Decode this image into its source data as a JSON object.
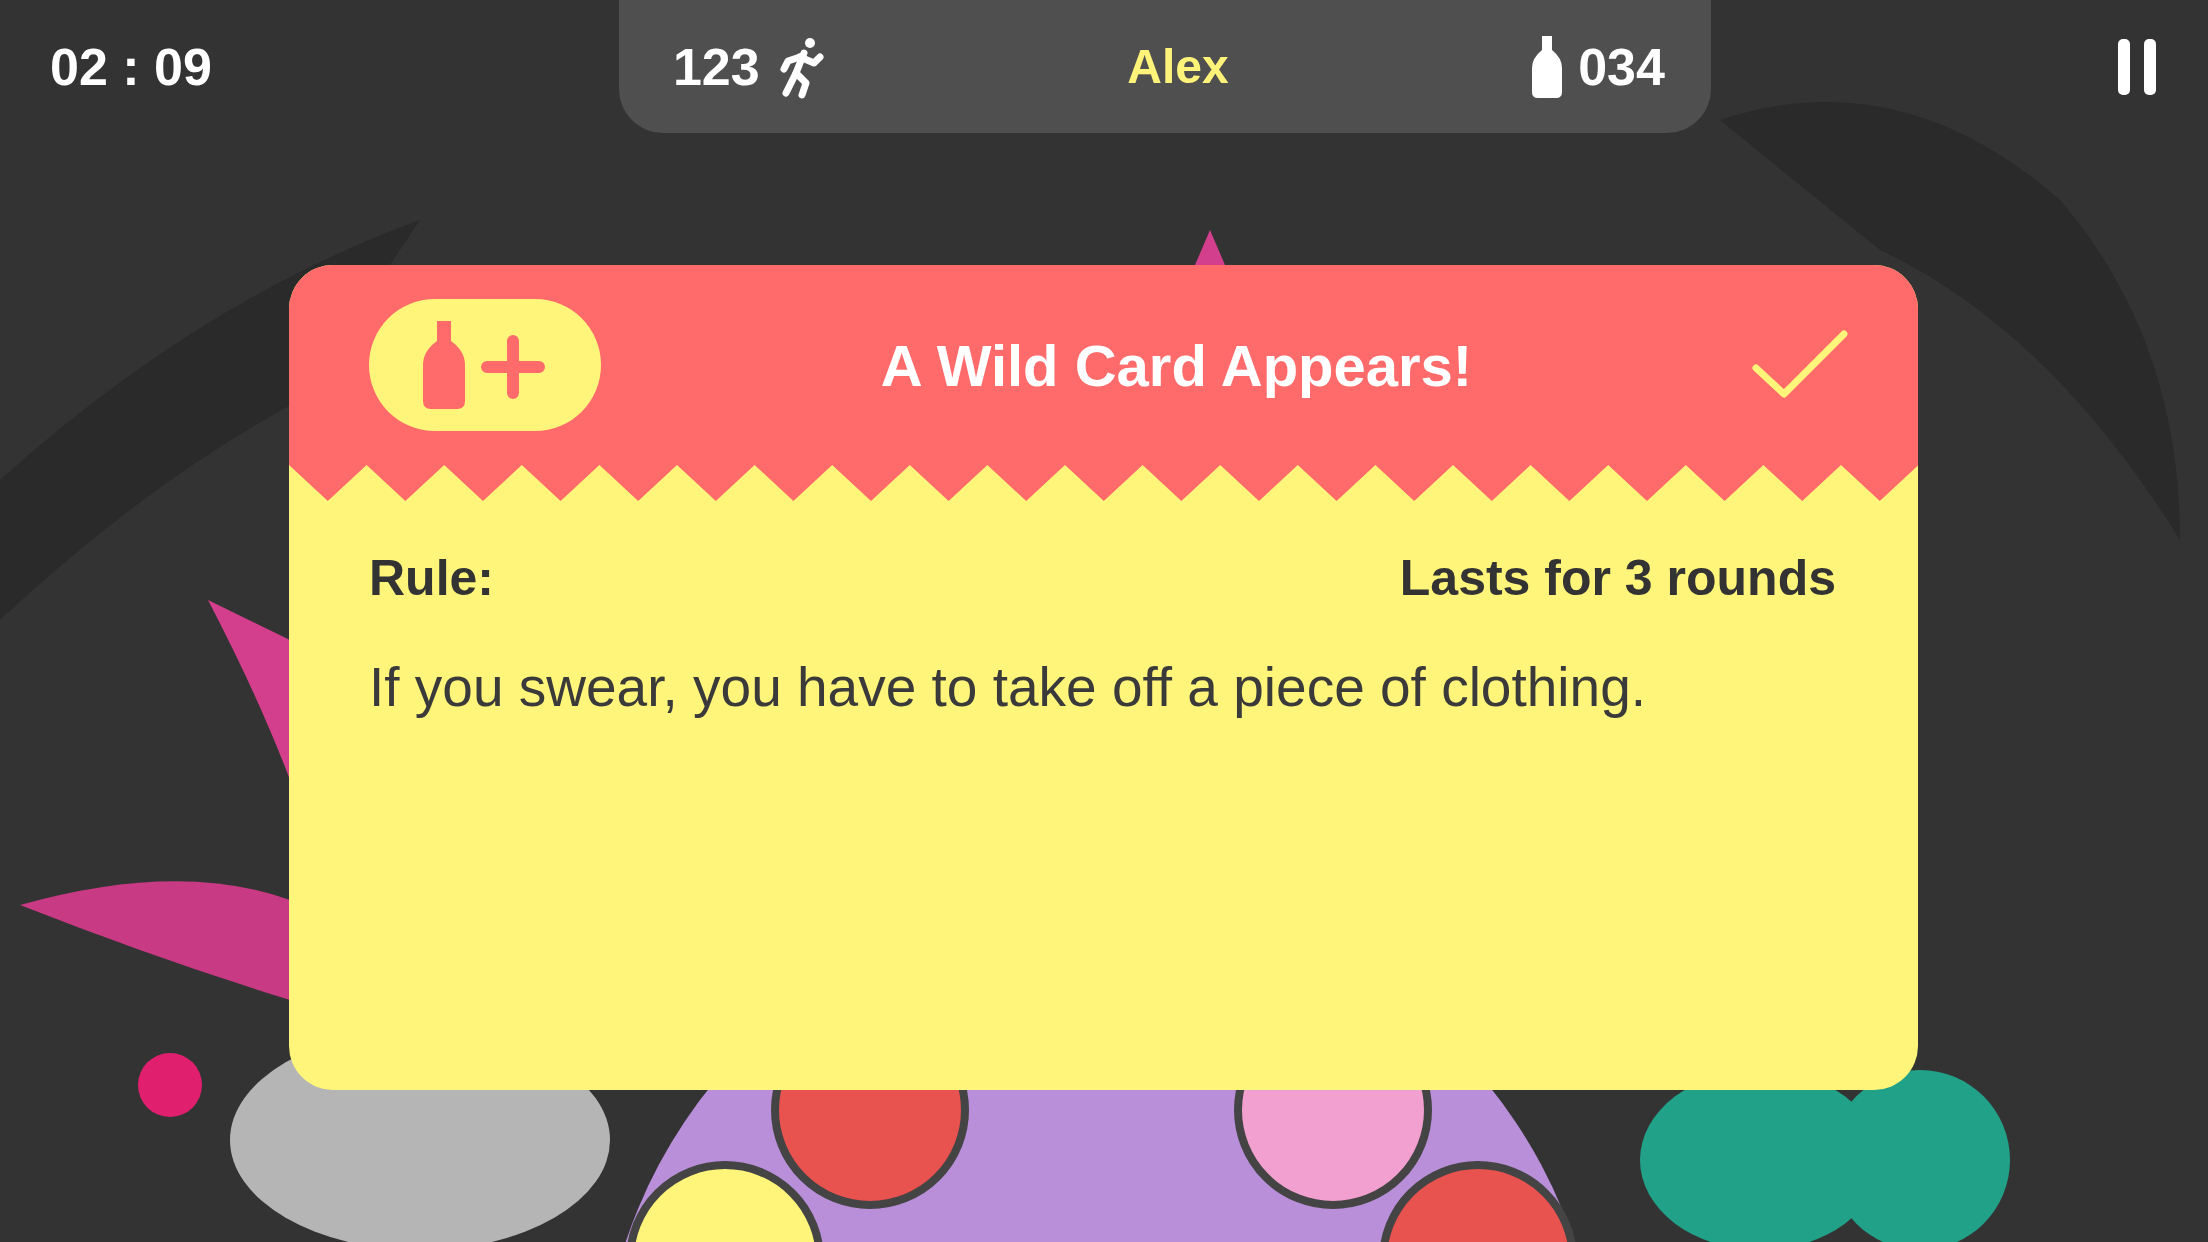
{
  "timer": "02 : 09",
  "scoreboard": {
    "steps": "123",
    "player": "Alex",
    "drinks": "034"
  },
  "card": {
    "title": "A Wild Card Appears!",
    "rule_label": "Rule:",
    "duration": "Lasts for 3 rounds",
    "rule_text": "If you swear, you have to take off a piece of clothing."
  }
}
